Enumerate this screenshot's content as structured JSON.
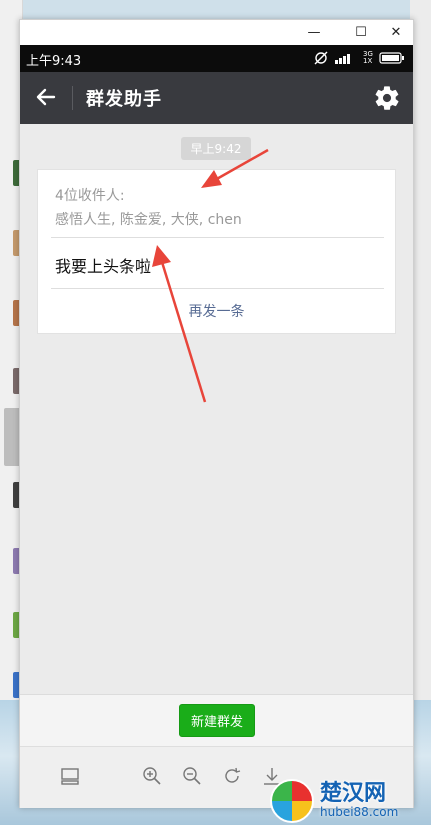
{
  "window": {
    "minimize_glyph": "—",
    "maximize_glyph": "☐",
    "close_glyph": "✕"
  },
  "status_bar": {
    "time": "上午9:43",
    "network_label": "3G 1X",
    "icons": [
      "sync-off-icon",
      "signal-icon",
      "battery-icon"
    ]
  },
  "app_bar": {
    "title": "群发助手",
    "back_icon": "arrow-left-icon",
    "settings_icon": "gear-icon"
  },
  "chat": {
    "timestamp": "早上9:42",
    "card": {
      "recipients_label": "4位收件人:",
      "recipients": "感悟人生, 陈金爱, 大侠, chen",
      "message": "我要上头条啦",
      "resend_label": "再发一条"
    }
  },
  "bottom": {
    "new_broadcast_label": "新建群发"
  },
  "toolbar": {
    "items": [
      "screen-icon",
      "zoom-in-icon",
      "zoom-out-icon",
      "rotate-icon",
      "download-icon"
    ]
  },
  "watermark": {
    "name": "楚汉网",
    "url": "hubei88.com"
  },
  "colors": {
    "app_bar": "#393a3f",
    "accent_green": "#1aad19",
    "link_blue": "#586c94",
    "annotation_red": "#e8453a"
  }
}
